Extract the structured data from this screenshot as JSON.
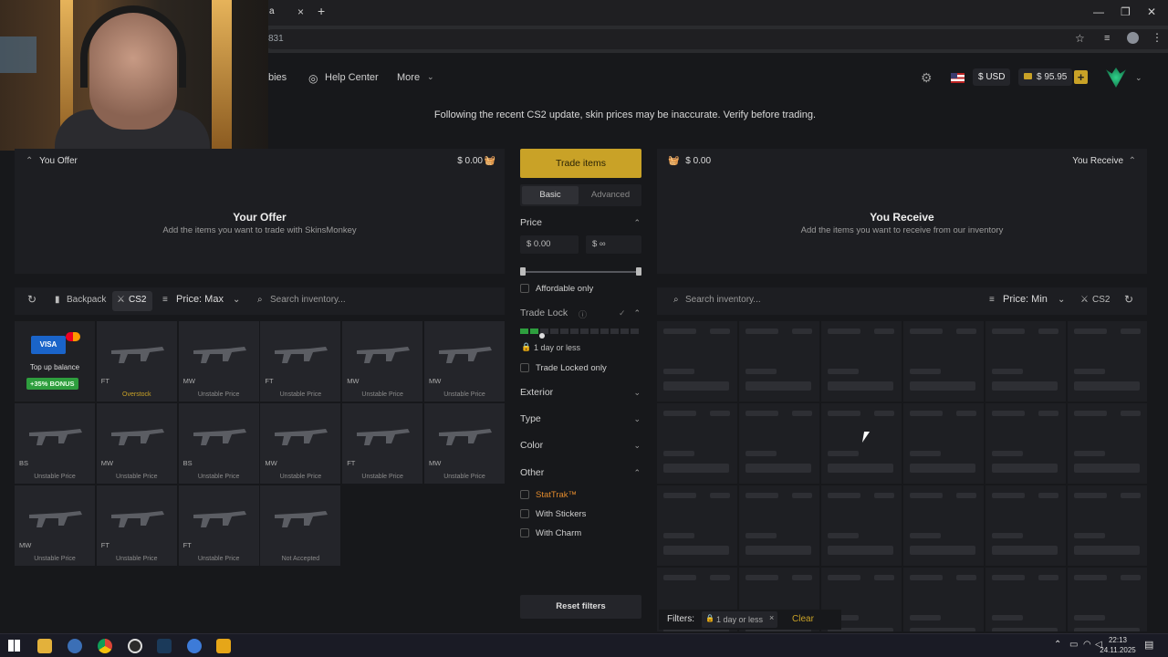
{
  "browser": {
    "address_fragment": "831",
    "tab_close": "×",
    "new_tab": "+"
  },
  "header": {
    "nav_partial": "bies",
    "help_center": "Help Center",
    "more": "More",
    "currency": "$ USD",
    "balance": "$ 95.95",
    "add_funds": "+"
  },
  "notice": "Following the recent CS2 update, skin prices may be inaccurate. Verify before trading.",
  "offer": {
    "head_label": "You Offer",
    "head_total": "$ 0.00",
    "title": "Your Offer",
    "subtitle": "Add the items you want to trade with SkinsMonkey"
  },
  "receive": {
    "head_label": "You Receive",
    "head_total": "$ 0.00",
    "title": "You Receive",
    "subtitle": "Add the items you want to receive from our inventory"
  },
  "left_toolbar": {
    "backpack": "Backpack",
    "game": "CS2",
    "sort": "Price: Max",
    "search_placeholder": "Search inventory..."
  },
  "right_toolbar": {
    "search_placeholder": "Search inventory...",
    "sort": "Price: Min",
    "game": "CS2"
  },
  "topup": {
    "card1": "VISA",
    "label": "Top up balance",
    "bonus": "+35% BONUS"
  },
  "inventory": [
    {
      "wear": "FT",
      "price": "Overstock",
      "yellow": true
    },
    {
      "wear": "MW",
      "price": "Unstable Price"
    },
    {
      "wear": "FT",
      "price": "Unstable Price"
    },
    {
      "wear": "MW",
      "price": "Unstable Price"
    },
    {
      "wear": "MW",
      "price": "Unstable Price"
    },
    {
      "wear": "BS",
      "price": "Unstable Price"
    },
    {
      "wear": "MW",
      "price": "Unstable Price"
    },
    {
      "wear": "BS",
      "price": "Unstable Price"
    },
    {
      "wear": "MW",
      "price": "Unstable Price"
    },
    {
      "wear": "FT",
      "price": "Unstable Price"
    },
    {
      "wear": "MW",
      "price": "Unstable Price"
    },
    {
      "wear": "MW",
      "price": "Unstable Price"
    },
    {
      "wear": "FT",
      "price": "Unstable Price"
    },
    {
      "wear": "FT",
      "price": "Unstable Price"
    },
    {
      "wear": "",
      "price": "Not Accepted"
    }
  ],
  "filters": {
    "trade_button": "Trade items",
    "mode_basic": "Basic",
    "mode_advanced": "Advanced",
    "price_label": "Price",
    "price_min": "$ 0.00",
    "price_max": "$ ∞",
    "affordable": "Affordable only",
    "trade_lock": "Trade Lock",
    "trade_lock_value": "1 day or less",
    "trade_locked_only": "Trade Locked only",
    "exterior": "Exterior",
    "type": "Type",
    "color": "Color",
    "other": "Other",
    "stattrak": "StatTrak™",
    "with_stickers": "With Stickers",
    "with_charm": "With Charm",
    "reset": "Reset filters"
  },
  "active_filters": {
    "label": "Filters:",
    "chip": "1 day or less",
    "clear": "Clear"
  },
  "taskbar": {
    "time": "22:13",
    "date": "24.11.2025"
  },
  "colors": {
    "accent_yellow": "#c9a227",
    "bonus_green": "#2e9e3e",
    "stattrak_orange": "#e08a2d"
  }
}
